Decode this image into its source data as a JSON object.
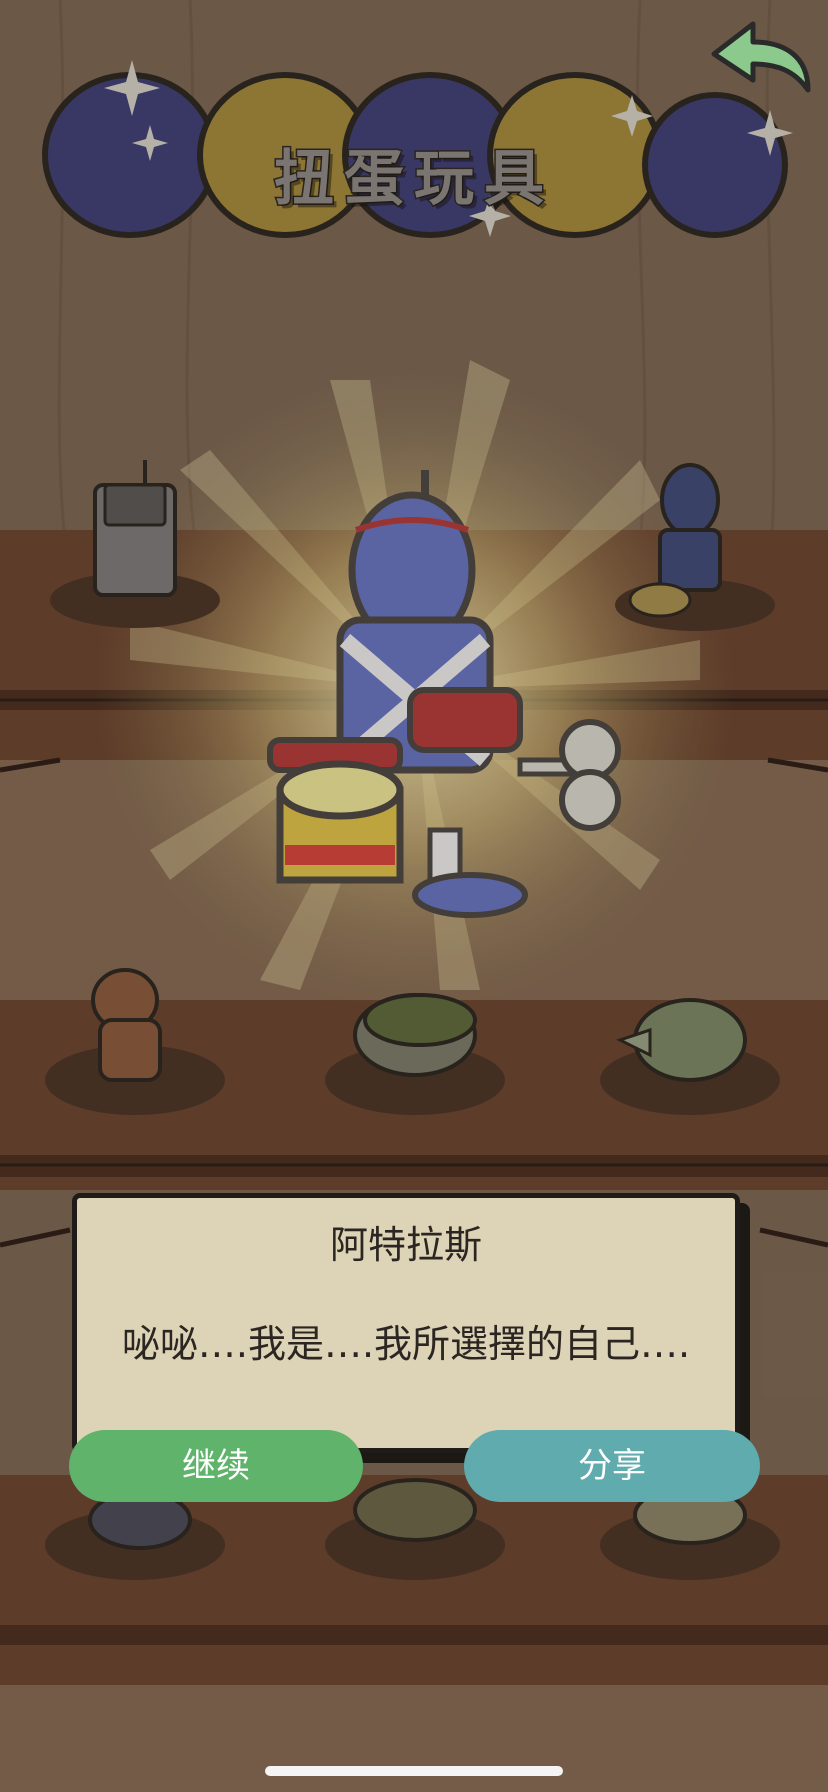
{
  "header": {
    "title": "扭蛋玩具"
  },
  "toolbar": {
    "back_icon": "back-arrow-icon"
  },
  "dialog": {
    "name": "阿特拉斯",
    "text": "咇咇….我是….我所選擇的自己…."
  },
  "buttons": {
    "continue_label": "继续",
    "share_label": "分享"
  },
  "colors": {
    "continue": "#60b36a",
    "share": "#5fabad",
    "dialog_bg": "#ddd3b6",
    "shelf": "#6a4430"
  }
}
